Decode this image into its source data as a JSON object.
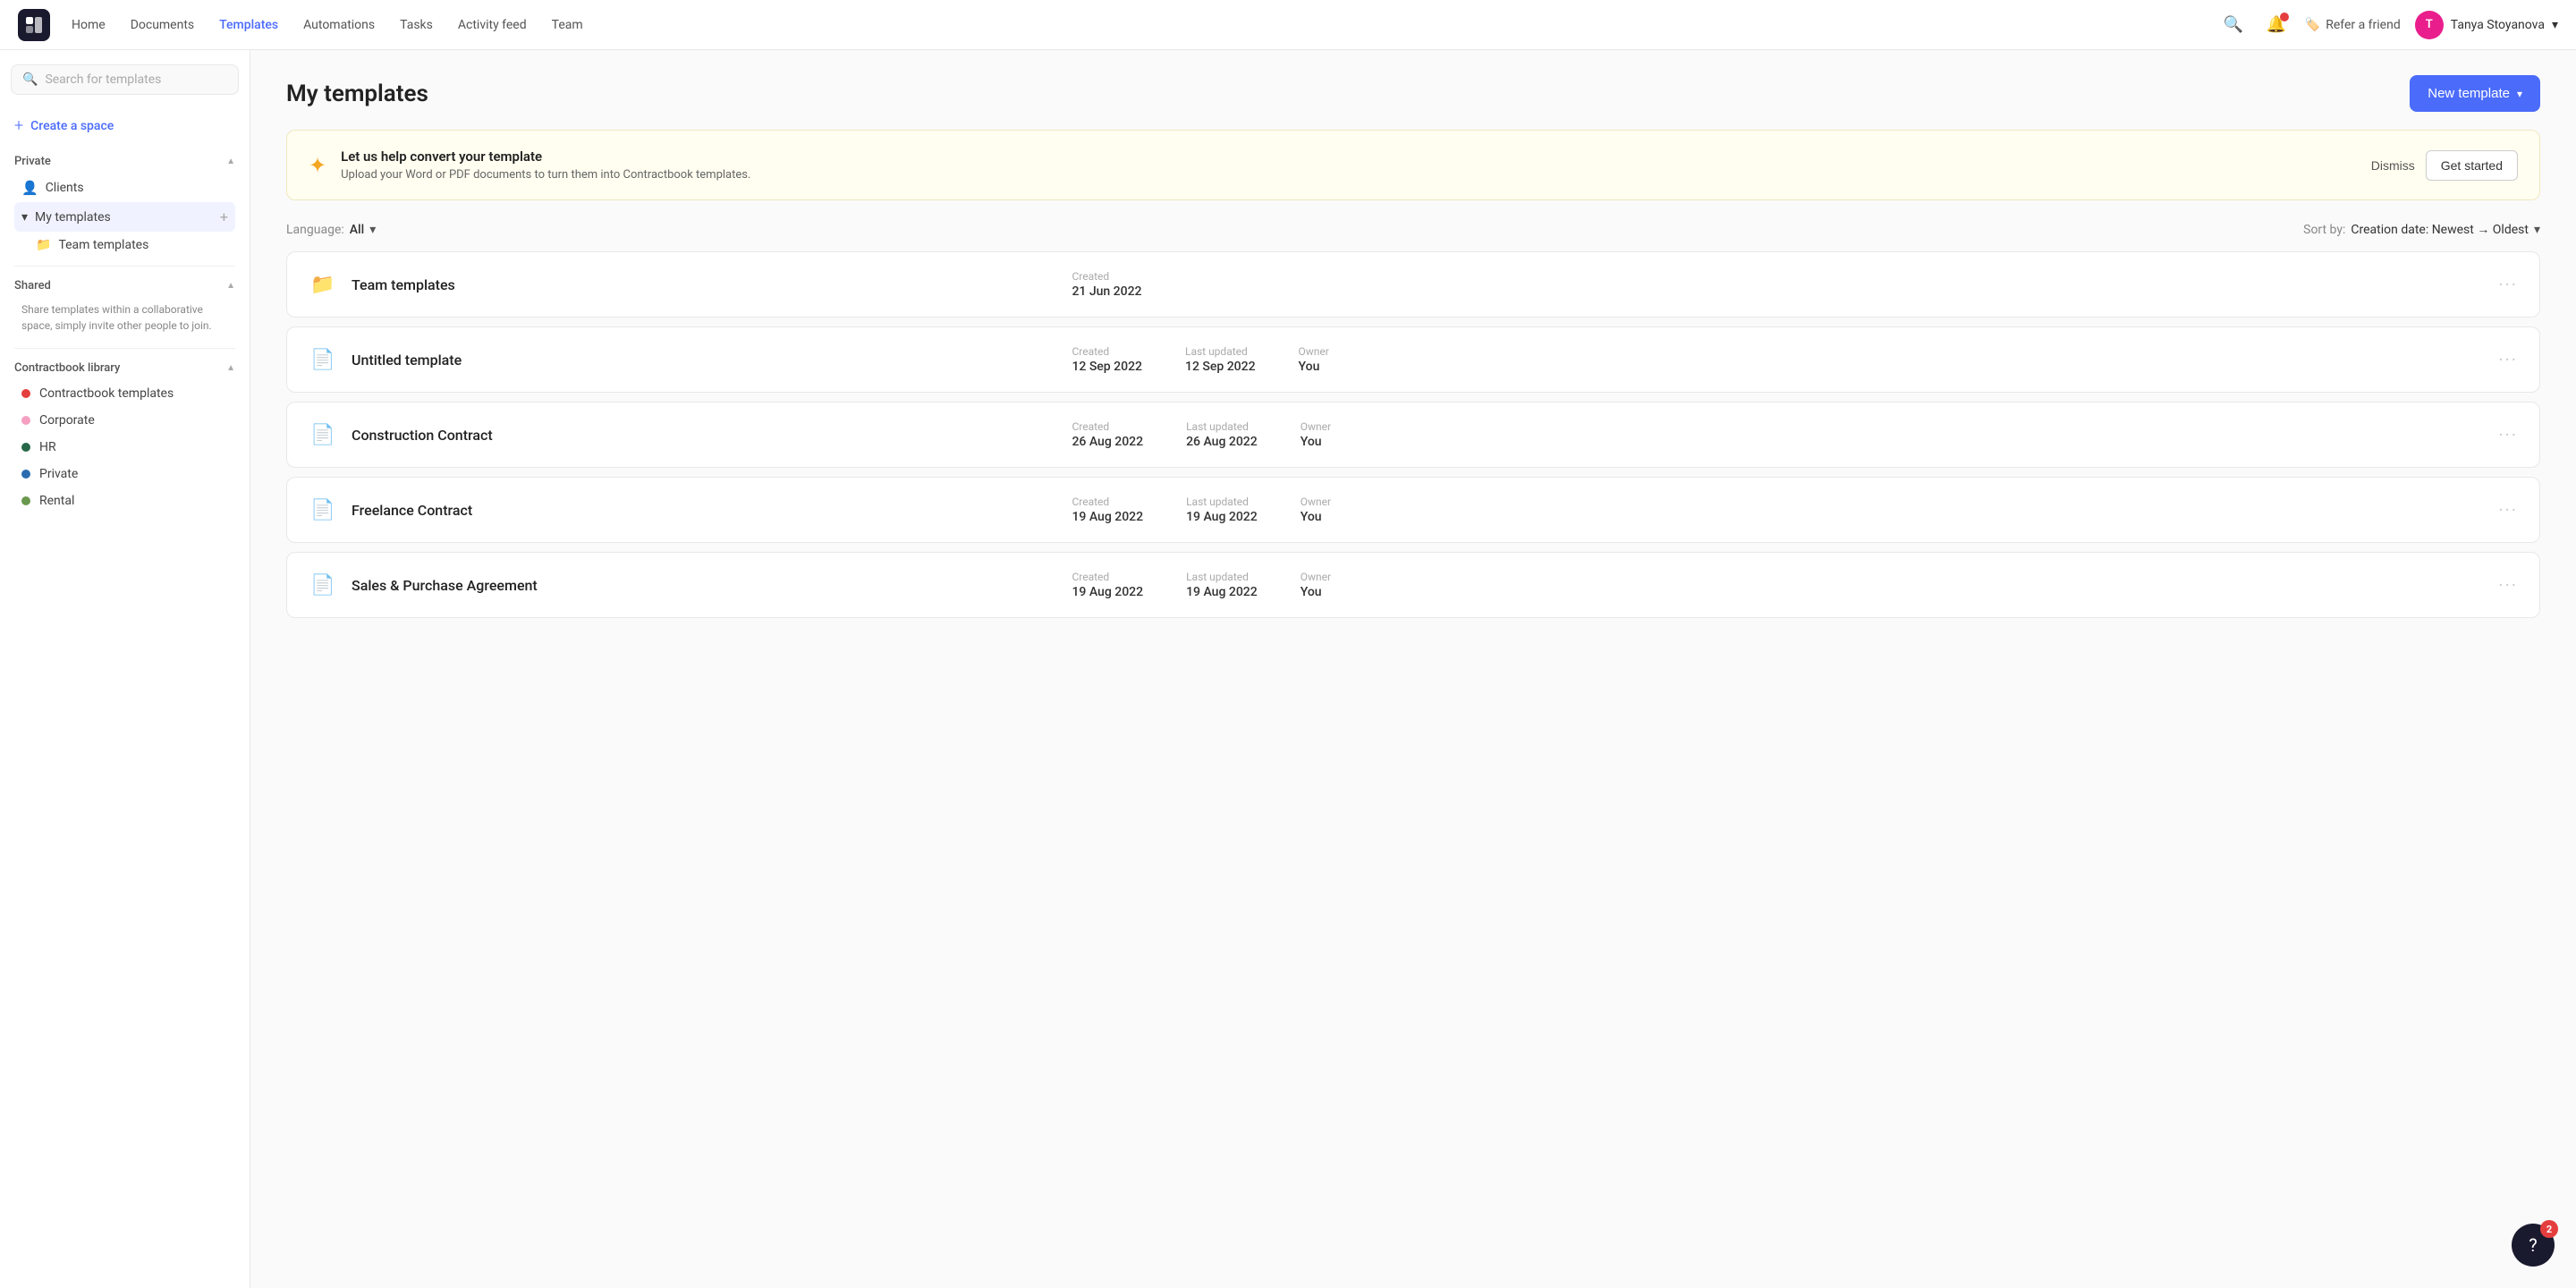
{
  "nav": {
    "links": [
      "Home",
      "Documents",
      "Templates",
      "Automations",
      "Tasks",
      "Activity feed",
      "Team"
    ],
    "active_link": "Templates",
    "refer_label": "Refer a friend",
    "user_name": "Tanya Stoyanova",
    "user_initials": "T"
  },
  "sidebar": {
    "search_placeholder": "Search for templates",
    "create_space_label": "Create a space",
    "private_section": "Private",
    "private_items": [
      {
        "name": "Clients",
        "icon": "👤"
      }
    ],
    "my_templates_label": "My templates",
    "team_templates_label": "Team templates",
    "shared_section": "Shared",
    "shared_description": "Share templates within a collaborative space, simply invite other people to join.",
    "library_section": "Contractbook library",
    "library_items": [
      {
        "name": "Contractbook templates",
        "color": "#e53e3e"
      },
      {
        "name": "Corporate",
        "color": "#f5a0c0"
      },
      {
        "name": "HR",
        "color": "#276749"
      },
      {
        "name": "Private",
        "color": "#2b6cb0"
      },
      {
        "name": "Rental",
        "color": "#6a994e"
      }
    ]
  },
  "main": {
    "title": "My templates",
    "new_template_btn": "New template",
    "promo": {
      "title": "Let us help convert your template",
      "description": "Upload your Word or PDF documents to turn them into Contractbook templates.",
      "dismiss_label": "Dismiss",
      "get_started_label": "Get started"
    },
    "language_label": "Language:",
    "language_value": "All",
    "sort_label": "Sort by:",
    "sort_value": "Creation date: Newest → Oldest",
    "templates": [
      {
        "name": "Team templates",
        "is_folder": true,
        "created_label": "Created",
        "created": "21 Jun 2022",
        "has_owner": false
      },
      {
        "name": "Untitled template",
        "is_folder": false,
        "created_label": "Created",
        "created": "12 Sep 2022",
        "updated_label": "Last updated",
        "updated": "12 Sep 2022",
        "owner_label": "Owner",
        "owner": "You"
      },
      {
        "name": "Construction Contract",
        "is_folder": false,
        "created_label": "Created",
        "created": "26 Aug 2022",
        "updated_label": "Last updated",
        "updated": "26 Aug 2022",
        "owner_label": "Owner",
        "owner": "You"
      },
      {
        "name": "Freelance Contract",
        "is_folder": false,
        "created_label": "Created",
        "created": "19 Aug 2022",
        "updated_label": "Last updated",
        "updated": "19 Aug 2022",
        "owner_label": "Owner",
        "owner": "You"
      },
      {
        "name": "Sales & Purchase Agreement",
        "is_folder": false,
        "created_label": "Created",
        "created": "19 Aug 2022",
        "updated_label": "Last updated",
        "updated": "19 Aug 2022",
        "owner_label": "Owner",
        "owner": "You"
      }
    ],
    "help_badge": "2"
  }
}
